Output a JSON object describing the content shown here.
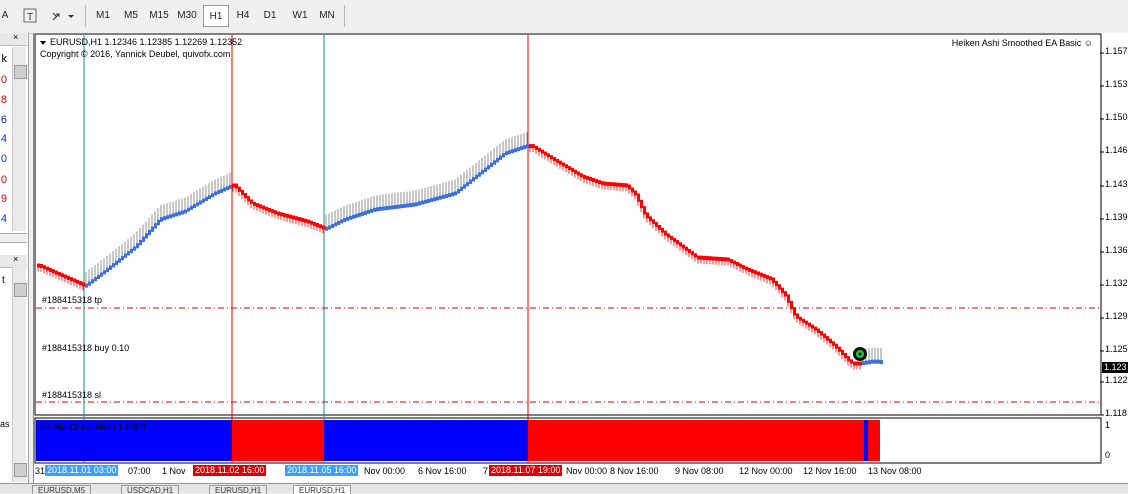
{
  "toolbar": {
    "partial_left": "A",
    "timeframes": [
      "M1",
      "M5",
      "M15",
      "M30",
      "H1",
      "H4",
      "D1",
      "W1",
      "MN"
    ],
    "active_timeframe": "H1"
  },
  "left_panel": {
    "markers": [
      "k",
      "0",
      "8",
      "6",
      "0",
      "0",
      "4",
      "9",
      "4"
    ],
    "partial_text": "t",
    "bottom_partial": "as"
  },
  "chart": {
    "symbol_line": "EURUSD,H1  1.12346 1.12385 1.12269 1.12352",
    "copyright": "Copyright © 2016, Yannick Deubel, quivofx.com",
    "ea_name": "Heiken Ashi Smoothed EA Basic ☺",
    "trades": {
      "tp": "#188415318 tp",
      "buy": "#188415318 buy 0.10",
      "sl": "#188415318 sl"
    },
    "price_axis": [
      "1.157",
      "1.153",
      "1.150",
      "1.146",
      "1.143",
      "1.139",
      "1.136",
      "1.132",
      "1.129",
      "1.125",
      "1.122",
      "1.118"
    ],
    "current_price": "1.123",
    "indicator": {
      "label": "H1 Ma Cross Histo 1.0000",
      "scale_top": "1",
      "scale_bottom": "0",
      "segments": [
        "blue",
        "red",
        "blue",
        "red",
        "blue",
        "red"
      ]
    },
    "time_axis": [
      "31",
      "2018.11.01 03:00",
      "07:00",
      "1 Nov",
      "2018.11.02 16:00",
      "2018.11.05 16:00",
      "Nov 00:00",
      "6 Nov 16:00",
      "7",
      "2018.11.07 19:00",
      "Nov 00:00",
      "8 Nov 16:00",
      "9 Nov 08:00",
      "12 Nov 00:00",
      "12 Nov 16:00",
      "13 Nov 08:00"
    ],
    "colors": {
      "bull": "#3c6fe0",
      "bear": "#ff0000",
      "histo_blue": "#0000ff",
      "histo_red": "#ff0000"
    }
  },
  "bottom_tabs": [
    "EURUSD,M5",
    "USDCAD,H1",
    "EURUSD,H1",
    "EURUSD,H1"
  ]
}
